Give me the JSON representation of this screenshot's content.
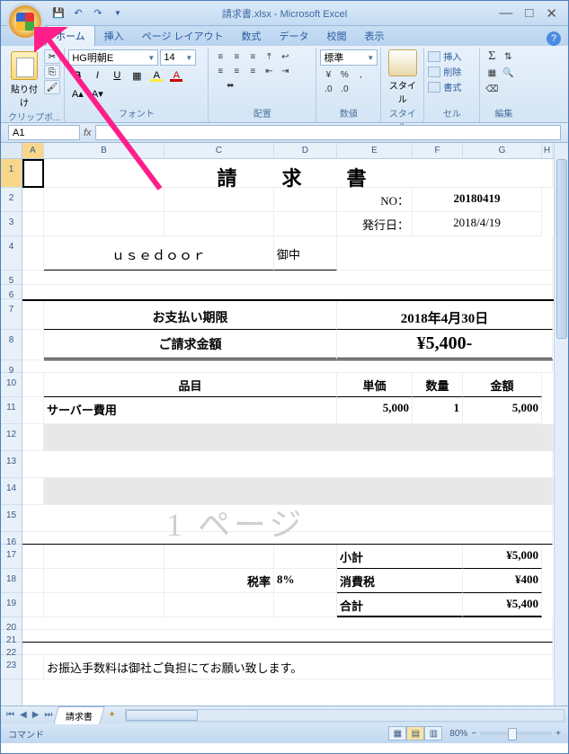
{
  "window": {
    "title": "請求書.xlsx - Microsoft Excel",
    "minimize": "—",
    "maximize": "□",
    "close": "✕"
  },
  "qat": {
    "save": "💾",
    "undo": "↶",
    "redo": "↷"
  },
  "tabs": {
    "home": "ホーム",
    "insert": "挿入",
    "layout": "ページ レイアウト",
    "formula": "数式",
    "data": "データ",
    "review": "校閲",
    "view": "表示"
  },
  "ribbon": {
    "clipboard": {
      "paste": "貼り付け",
      "label": "クリップボ..."
    },
    "font": {
      "name": "HG明朝E",
      "size": "14",
      "label": "フォント",
      "bold": "B",
      "italic": "I",
      "underline": "U"
    },
    "alignment": {
      "label": "配置"
    },
    "number": {
      "style": "標準",
      "label": "数値"
    },
    "styles": {
      "button": "スタイル",
      "label": "スタイル"
    },
    "cells": {
      "insert": "挿入",
      "delete": "削除",
      "format": "書式",
      "label": "セル"
    },
    "editing": {
      "label": "編集"
    }
  },
  "namebox": "A1",
  "fx_label": "fx",
  "cols": [
    "A",
    "B",
    "C",
    "D",
    "E",
    "F",
    "G",
    "H"
  ],
  "rows": [
    "1",
    "2",
    "3",
    "4",
    "5",
    "6",
    "7",
    "8",
    "9",
    "10",
    "11",
    "12",
    "13",
    "14",
    "15",
    "16",
    "17",
    "18",
    "19",
    "20",
    "21",
    "22",
    "23"
  ],
  "doc": {
    "title": "請　求　書",
    "no_label": "NO：",
    "no_value": "20180419",
    "date_label": "発行日：",
    "date_value": "2018/4/19",
    "customer": "ｕｓｅｄｏｏｒ",
    "honor": "御中",
    "due_label": "お支払い期限",
    "due_value": "2018年4月30日",
    "amount_label": "ご請求金額",
    "amount_value": "¥5,400-",
    "hdr_item": "品目",
    "hdr_price": "単価",
    "hdr_qty": "数量",
    "hdr_amount": "金額",
    "line1_item": "サーバー費用",
    "line1_price": "5,000",
    "line1_qty": "1",
    "line1_amount": "5,000",
    "watermark": "1 ページ",
    "taxrate_label": "税率",
    "taxrate_value": "8%",
    "subtotal_label": "小計",
    "subtotal_value": "¥5,000",
    "tax_label": "消費税",
    "tax_value": "¥400",
    "total_label": "合計",
    "total_value": "¥5,400",
    "note": "お振込手数料は御社ご負担にてお願い致します。"
  },
  "sheet_tab": "請求書",
  "status": "コマンド",
  "zoom": "80%",
  "zoom_minus": "−",
  "zoom_plus": "+"
}
